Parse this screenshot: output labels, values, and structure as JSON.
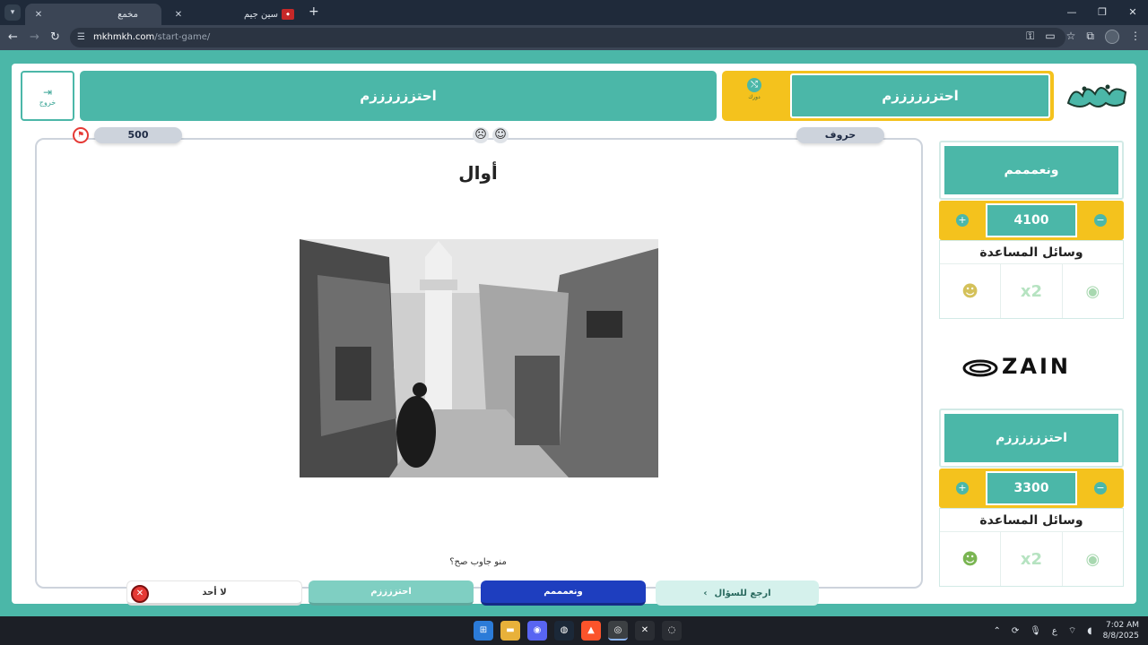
{
  "browser": {
    "tabs": [
      {
        "title": "مخمع",
        "active": true
      },
      {
        "title": "سين جيم",
        "active": false
      }
    ],
    "url_host": "mkhmkh.com",
    "url_path": "/start-game/"
  },
  "header": {
    "exit_label": "خروج",
    "team2_banner": "احتززززززم",
    "turn_team": "احتززززززم",
    "turn_label": "دورك"
  },
  "question": {
    "points": "500",
    "category": "حروف",
    "title": "أوال",
    "footer_prompt": "منو جاوب صح؟"
  },
  "answers": {
    "none": "لا أحد",
    "team2": "احتززززم",
    "team1": "ونعمممم",
    "back": "ارجع للسؤال"
  },
  "teams": [
    {
      "name": "ونعمممم",
      "score": "4100",
      "helps_title": "وسائل المساعدة",
      "help_x2": "x2"
    },
    {
      "name": "احتززززززم",
      "score": "3300",
      "helps_title": "وسائل المساعدة",
      "help_x2": "x2"
    }
  ],
  "sponsor": "ZAIN",
  "taskbar": {
    "time": "7:02 AM",
    "date": "8/8/2025",
    "lang": "ع"
  },
  "colors": {
    "teal": "#4bb7a8",
    "yellow": "#f4c21d",
    "blue": "#1e3ebf",
    "red": "#e53935"
  }
}
